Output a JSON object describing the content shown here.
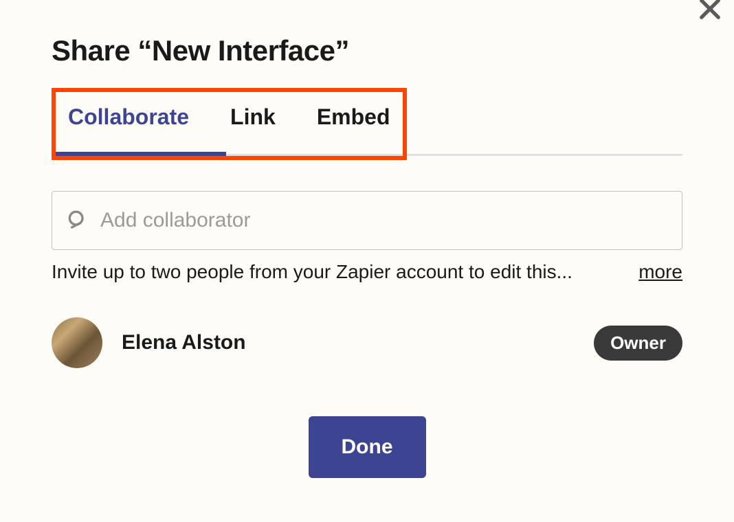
{
  "dialog": {
    "title": "Share “New Interface”"
  },
  "tabs": {
    "collaborate": "Collaborate",
    "link": "Link",
    "embed": "Embed"
  },
  "search": {
    "placeholder": "Add collaborator"
  },
  "helper": {
    "text": "Invite up to two people from your Zapier account to edit this...",
    "more": "more"
  },
  "collaborator": {
    "name": "Elena Alston",
    "role": "Owner"
  },
  "actions": {
    "done": "Done"
  }
}
